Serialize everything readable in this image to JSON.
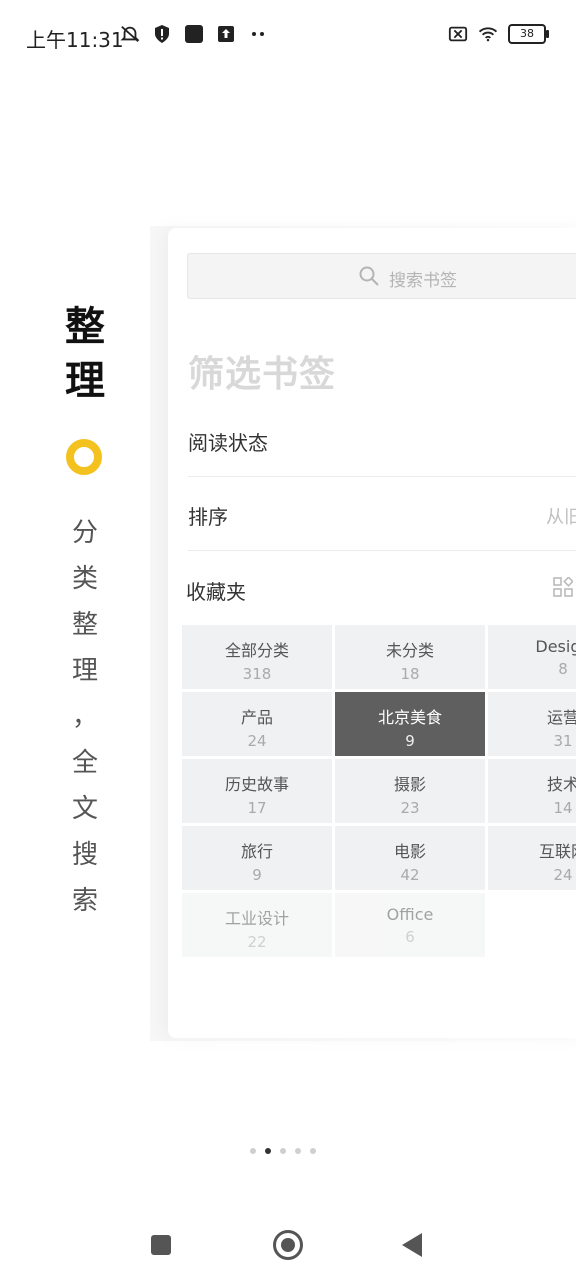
{
  "status_bar": {
    "time": "上午11:31",
    "icons_left": [
      "bell-off-icon",
      "shield-alert-icon",
      "app-square-icon",
      "upload-icon",
      "more-dots-icon"
    ],
    "icons_right": [
      "sim-off-icon",
      "wifi-icon",
      "battery-icon"
    ],
    "battery_level": "38"
  },
  "feature": {
    "title_line1": "整",
    "title_line2": "理",
    "accent_color": "#f4c21f",
    "desc_chars": [
      "分",
      "类",
      "整",
      "理",
      "，",
      "全",
      "文",
      "搜",
      "索"
    ]
  },
  "search": {
    "placeholder": "搜索书签"
  },
  "filter": {
    "title": "筛选书签",
    "reading_status_label": "阅读状态",
    "sort_label": "排序",
    "sort_value": "从旧",
    "favorites_label": "收藏夹"
  },
  "categories": [
    {
      "name": "全部分类",
      "count": "318"
    },
    {
      "name": "未分类",
      "count": "18"
    },
    {
      "name": "Design",
      "count": "8"
    },
    {
      "name": "产品",
      "count": "24"
    },
    {
      "name": "北京美食",
      "count": "9",
      "selected": true
    },
    {
      "name": "运营",
      "count": "31"
    },
    {
      "name": "历史故事",
      "count": "17"
    },
    {
      "name": "摄影",
      "count": "23"
    },
    {
      "name": "技术",
      "count": "14"
    },
    {
      "name": "旅行",
      "count": "9"
    },
    {
      "name": "电影",
      "count": "42"
    },
    {
      "name": "互联网",
      "count": "24"
    },
    {
      "name": "工业设计",
      "count": "22"
    },
    {
      "name": "Office",
      "count": "6"
    }
  ],
  "pager": {
    "count": 5,
    "active_index": 1
  },
  "colors": {
    "selected_tile": "#5f5f5f",
    "tile_bg": "#f0f1f2"
  }
}
